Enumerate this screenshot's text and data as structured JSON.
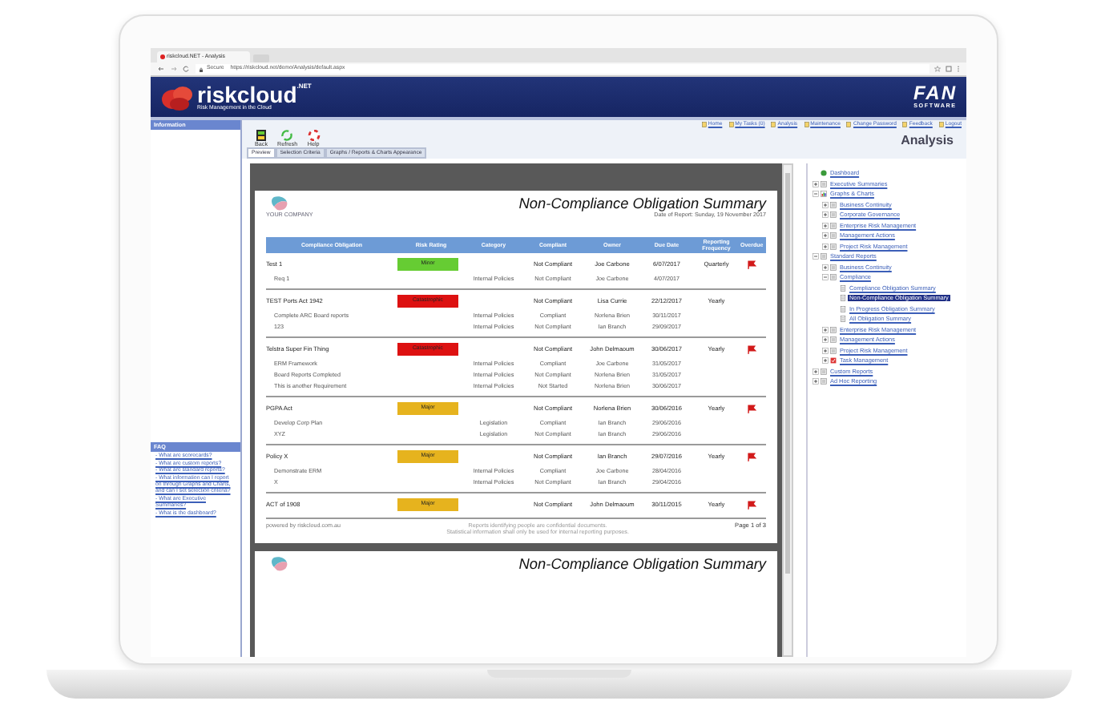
{
  "browser": {
    "tab_title": "riskcloud.NET - Analysis",
    "secure_label": "Secure",
    "url": "https://riskcloud.net/demo/Analysis/default.aspx"
  },
  "banner": {
    "logo": "riskcloud",
    "logo_suffix": ".NET",
    "tagline": "Risk Management in the Cloud",
    "partner_logo": "FAN",
    "partner_sub": "SOFTWARE"
  },
  "sidebar": {
    "information_title": "Information",
    "faq_title": "FAQ",
    "faq": [
      {
        "label": "- What are scorecards?"
      },
      {
        "label": "- What are custom reports?"
      },
      {
        "label": "- What are standard reports?"
      },
      {
        "label": "- What information can I report on through Graphs and Charts, and can I set selection criteria?"
      },
      {
        "label": "- What are Executive Summaries?"
      },
      {
        "label": "- What is the dashboard?"
      }
    ]
  },
  "top_links": [
    {
      "label": "Home"
    },
    {
      "label": "My Tasks (0)"
    },
    {
      "label": "Analysis"
    },
    {
      "label": "Maintenance"
    },
    {
      "label": "Change Password"
    },
    {
      "label": "Feedback"
    },
    {
      "label": "Logout"
    }
  ],
  "toolbar": [
    {
      "label": "Back",
      "kind": "back"
    },
    {
      "label": "Refresh",
      "kind": "refresh"
    },
    {
      "label": "Help",
      "kind": "help"
    }
  ],
  "page_title": "Analysis",
  "tabs": [
    {
      "label": "Preview",
      "selected": true
    },
    {
      "label": "Selection Criteria",
      "selected": false
    },
    {
      "label": "Graphs / Reports & Charts Appearance",
      "selected": false
    }
  ],
  "report": {
    "company": "YOUR COMPANY",
    "title": "Non-Compliance Obligation Summary",
    "date": "Date of Report: Sunday, 19 November 2017",
    "columns": [
      "Compliance Obligation",
      "Risk Rating",
      "Category",
      "Compliant",
      "Owner",
      "Due Date",
      "Reporting Frequency",
      "Overdue"
    ],
    "groups": [
      {
        "obligation": "Test 1",
        "rating": "Minor",
        "color": "#66cc33",
        "compliant": "Not Compliant",
        "owner": "Joe Carbone",
        "due": "6/07/2017",
        "frequency": "Quarterly",
        "overdue": true,
        "requirements": [
          {
            "name": "Req 1",
            "category": "Internal Policies",
            "compliant": "Not Compliant",
            "owner": "Joe Carbone",
            "due": "4/07/2017"
          }
        ]
      },
      {
        "obligation": "TEST Ports Act 1942",
        "rating": "Catastrophic",
        "color": "#dd1111",
        "compliant": "Not Compliant",
        "owner": "Lisa Currie",
        "due": "22/12/2017",
        "frequency": "Yearly",
        "overdue": false,
        "requirements": [
          {
            "name": "Complete ARC Board reports",
            "category": "Internal Policies",
            "compliant": "Compliant",
            "owner": "Norlena Brien",
            "due": "30/11/2017"
          },
          {
            "name": "123",
            "category": "Internal Policies",
            "compliant": "Not Compliant",
            "owner": "Ian Branch",
            "due": "29/09/2017"
          }
        ]
      },
      {
        "obligation": "Telstra Super Fin Thing",
        "rating": "Catastrophic",
        "color": "#dd1111",
        "compliant": "Not Compliant",
        "owner": "John Delmaoum",
        "due": "30/06/2017",
        "frequency": "Yearly",
        "overdue": true,
        "requirements": [
          {
            "name": "ERM Framework",
            "category": "Internal Policies",
            "compliant": "Compliant",
            "owner": "Joe Carbone",
            "due": "31/05/2017"
          },
          {
            "name": "Board Reports Completed",
            "category": "Internal Policies",
            "compliant": "Not Compliant",
            "owner": "Norlena Brien",
            "due": "31/05/2017"
          },
          {
            "name": "This is another Requirement",
            "category": "Internal Policies",
            "compliant": "Not Started",
            "owner": "Norlena Brien",
            "due": "30/06/2017"
          }
        ]
      },
      {
        "obligation": "PGPA Act",
        "rating": "Major",
        "color": "#e6b31e",
        "compliant": "Not Compliant",
        "owner": "Norlena Brien",
        "due": "30/06/2016",
        "frequency": "Yearly",
        "overdue": true,
        "requirements": [
          {
            "name": "Develop Corp Plan",
            "category": "Legislation",
            "compliant": "Compliant",
            "owner": "Ian Branch",
            "due": "29/06/2016"
          },
          {
            "name": "XYZ",
            "category": "Legislation",
            "compliant": "Not Compliant",
            "owner": "Ian Branch",
            "due": "29/06/2016"
          }
        ]
      },
      {
        "obligation": "Policy X",
        "rating": "Major",
        "color": "#e6b31e",
        "compliant": "Not Compliant",
        "owner": "Ian Branch",
        "due": "29/07/2016",
        "frequency": "Yearly",
        "overdue": true,
        "requirements": [
          {
            "name": "Demonstrate ERM",
            "category": "Internal Policies",
            "compliant": "Compliant",
            "owner": "Joe Carbone",
            "due": "28/04/2016"
          },
          {
            "name": "X",
            "category": "Internal Policies",
            "compliant": "Not Compliant",
            "owner": "Ian Branch",
            "due": "29/04/2016"
          }
        ]
      },
      {
        "obligation": "ACT of 1908",
        "rating": "Major",
        "color": "#e6b31e",
        "compliant": "Not Compliant",
        "owner": "John Delmaoum",
        "due": "30/11/2015",
        "frequency": "Yearly",
        "overdue": true
      }
    ],
    "powered": "powered by riskcloud.com.au",
    "notice_1": "Reports identifying people are confidential documents.",
    "notice_2": "Statistical information shall only be used for internal reporting purposes.",
    "page": "Page 1 of 3"
  },
  "next_page": {
    "title": "Non-Compliance Obligation Summary"
  },
  "tree": [
    {
      "label": "Dashboard",
      "kind": "dashboard",
      "selected": false
    },
    {
      "label": "Executive Summaries",
      "kind": "group",
      "selected": false,
      "expanded": false
    },
    {
      "label": "Graphs & Charts",
      "kind": "charts",
      "selected": false,
      "expanded": true,
      "children": [
        {
          "label": "Business Continuity",
          "kind": "group",
          "selected": false,
          "expanded": false
        },
        {
          "label": "Corporate Governance",
          "kind": "group",
          "selected": false,
          "expanded": false
        },
        {
          "label": "Enterprise Risk Management",
          "kind": "group",
          "selected": false,
          "expanded": false
        },
        {
          "label": "Management Actions",
          "kind": "group",
          "selected": false,
          "expanded": false
        },
        {
          "label": "Project Risk Management",
          "kind": "group",
          "selected": false,
          "expanded": false
        }
      ]
    },
    {
      "label": "Standard Reports",
      "kind": "group",
      "selected": false,
      "expanded": true,
      "children": [
        {
          "label": "Business Continuity",
          "kind": "group",
          "selected": false,
          "expanded": false
        },
        {
          "label": "Compliance",
          "kind": "group",
          "selected": false,
          "expanded": true,
          "children": [
            {
              "label": "Compliance Obligation Summary",
              "kind": "report",
              "selected": false
            },
            {
              "label": "Non-Compliance Obligation Summary",
              "kind": "report",
              "selected": true
            },
            {
              "label": "In Progress Obligation Summary",
              "kind": "report",
              "selected": false
            },
            {
              "label": "All Obligation Summary",
              "kind": "report",
              "selected": false
            }
          ]
        },
        {
          "label": "Enterprise Risk Management",
          "kind": "group",
          "selected": false,
          "expanded": false
        },
        {
          "label": "Management Actions",
          "kind": "group",
          "selected": false,
          "expanded": false
        },
        {
          "label": "Project Risk Management",
          "kind": "group",
          "selected": false,
          "expanded": false
        },
        {
          "label": "Task Management",
          "kind": "task",
          "selected": false,
          "expanded": false
        }
      ]
    },
    {
      "label": "Custom Reports",
      "kind": "group",
      "selected": false,
      "expanded": false
    },
    {
      "label": "Ad Hoc Reporting",
      "kind": "group",
      "selected": false,
      "expanded": false
    }
  ]
}
